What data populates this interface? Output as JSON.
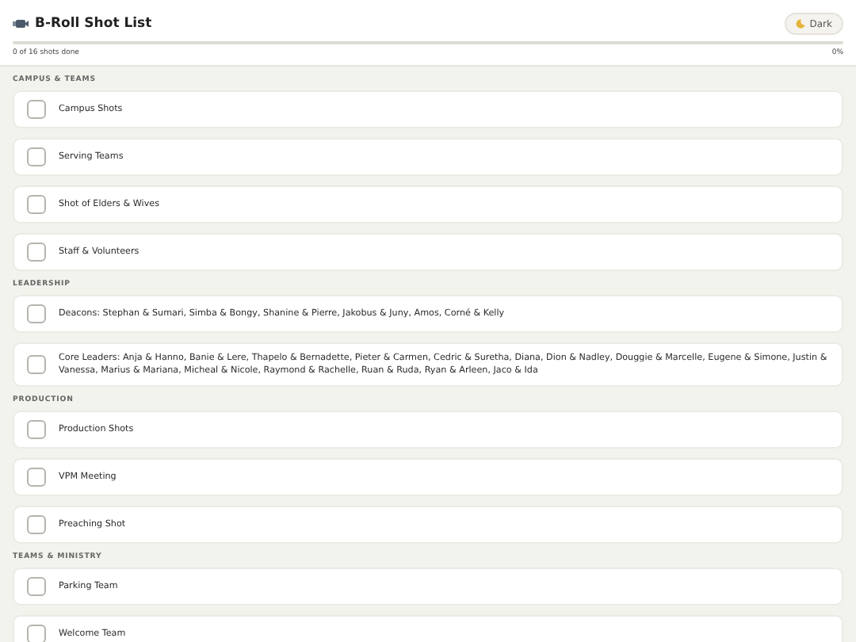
{
  "header": {
    "title": "B-Roll Shot List",
    "theme_button": {
      "label": "Dark"
    },
    "progress": {
      "level": 0,
      "summary": "0 of 16 shots done",
      "percent": "0%"
    }
  },
  "sections": [
    {
      "title": "CAMPUS & TEAMS",
      "items": [
        {
          "label": "Campus Shots",
          "checked": false
        },
        {
          "label": "Serving Teams",
          "checked": false
        },
        {
          "label": "Shot of Elders & Wives",
          "checked": false
        },
        {
          "label": "Staff & Volunteers",
          "checked": false
        }
      ]
    },
    {
      "title": "LEADERSHIP",
      "items": [
        {
          "label": "Deacons: Stephan & Sumari, Simba & Bongy, Shanine & Pierre, Jakobus & Juny, Amos, Corné & Kelly",
          "checked": false
        },
        {
          "label": "Core Leaders: Anja & Hanno, Banie & Lere, Thapelo & Bernadette, Pieter & Carmen, Cedric & Suretha, Diana, Dion & Nadley, Douggie & Marcelle, Eugene & Simone, Justin & Vanessa, Marius & Mariana, Micheal & Nicole, Raymond & Rachelle, Ruan & Ruda, Ryan & Arleen, Jaco & Ida",
          "checked": false
        }
      ]
    },
    {
      "title": "PRODUCTION",
      "items": [
        {
          "label": "Production Shots",
          "checked": false
        },
        {
          "label": "VPM Meeting",
          "checked": false
        },
        {
          "label": "Preaching Shot",
          "checked": false
        }
      ]
    },
    {
      "title": "TEAMS & MINISTRY",
      "items": [
        {
          "label": "Parking Team",
          "checked": false
        },
        {
          "label": "Welcome Team",
          "checked": false
        }
      ]
    }
  ]
}
